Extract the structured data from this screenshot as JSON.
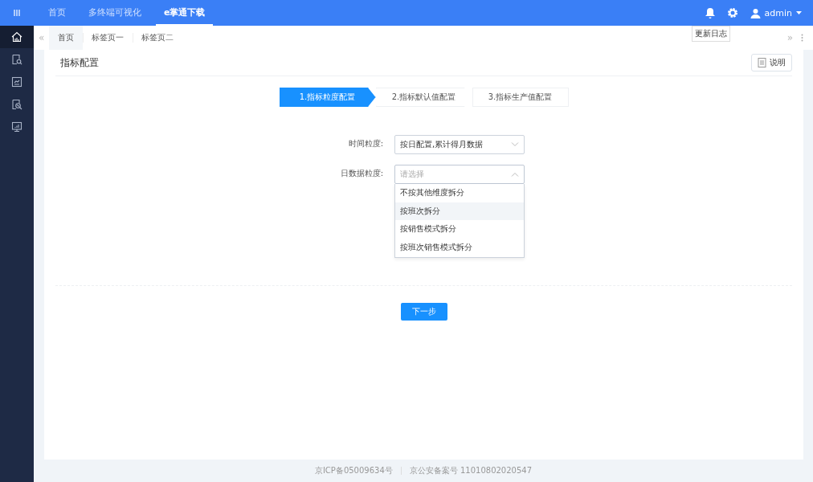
{
  "top_nav": [
    {
      "label": "首页",
      "selected": false
    },
    {
      "label": "多终端可视化",
      "selected": false
    },
    {
      "label": "e掌通下载",
      "selected": true
    }
  ],
  "user": {
    "name": "admin"
  },
  "tooltip": "更新日志",
  "sidebar": {
    "items": [
      {
        "selected": true
      },
      {
        "selected": false
      },
      {
        "selected": false
      },
      {
        "selected": false
      },
      {
        "selected": false
      }
    ]
  },
  "page_tabs": {
    "prev": "«",
    "next": "»",
    "items": [
      {
        "label": "首页",
        "selected": true
      },
      {
        "label": "标签页一",
        "selected": false
      },
      {
        "label": "标签页二",
        "selected": false
      }
    ]
  },
  "card": {
    "title": "指标配置",
    "help_button": "说明"
  },
  "steps": [
    {
      "label": "1.指标粒度配置",
      "selected": true
    },
    {
      "label": "2.指标默认值配置",
      "selected": false
    },
    {
      "label": "3.指标生产值配置",
      "selected": false
    }
  ],
  "form": [
    {
      "label": "时间粒度:",
      "value": "按日配置,累计得月数据",
      "expanded": false
    },
    {
      "label": "日数据粒度:",
      "placeholder": "请选择",
      "expanded": true,
      "options": [
        {
          "label": "不按其他维度拆分",
          "selected": false
        },
        {
          "label": "按班次拆分",
          "selected": true
        },
        {
          "label": "按销售模式拆分",
          "selected": false
        },
        {
          "label": "按班次销售模式拆分",
          "selected": false
        }
      ]
    }
  ],
  "next_button": "下一步",
  "footer": [
    "京ICP备05009634号",
    "京公安备案号 11010802020547"
  ]
}
